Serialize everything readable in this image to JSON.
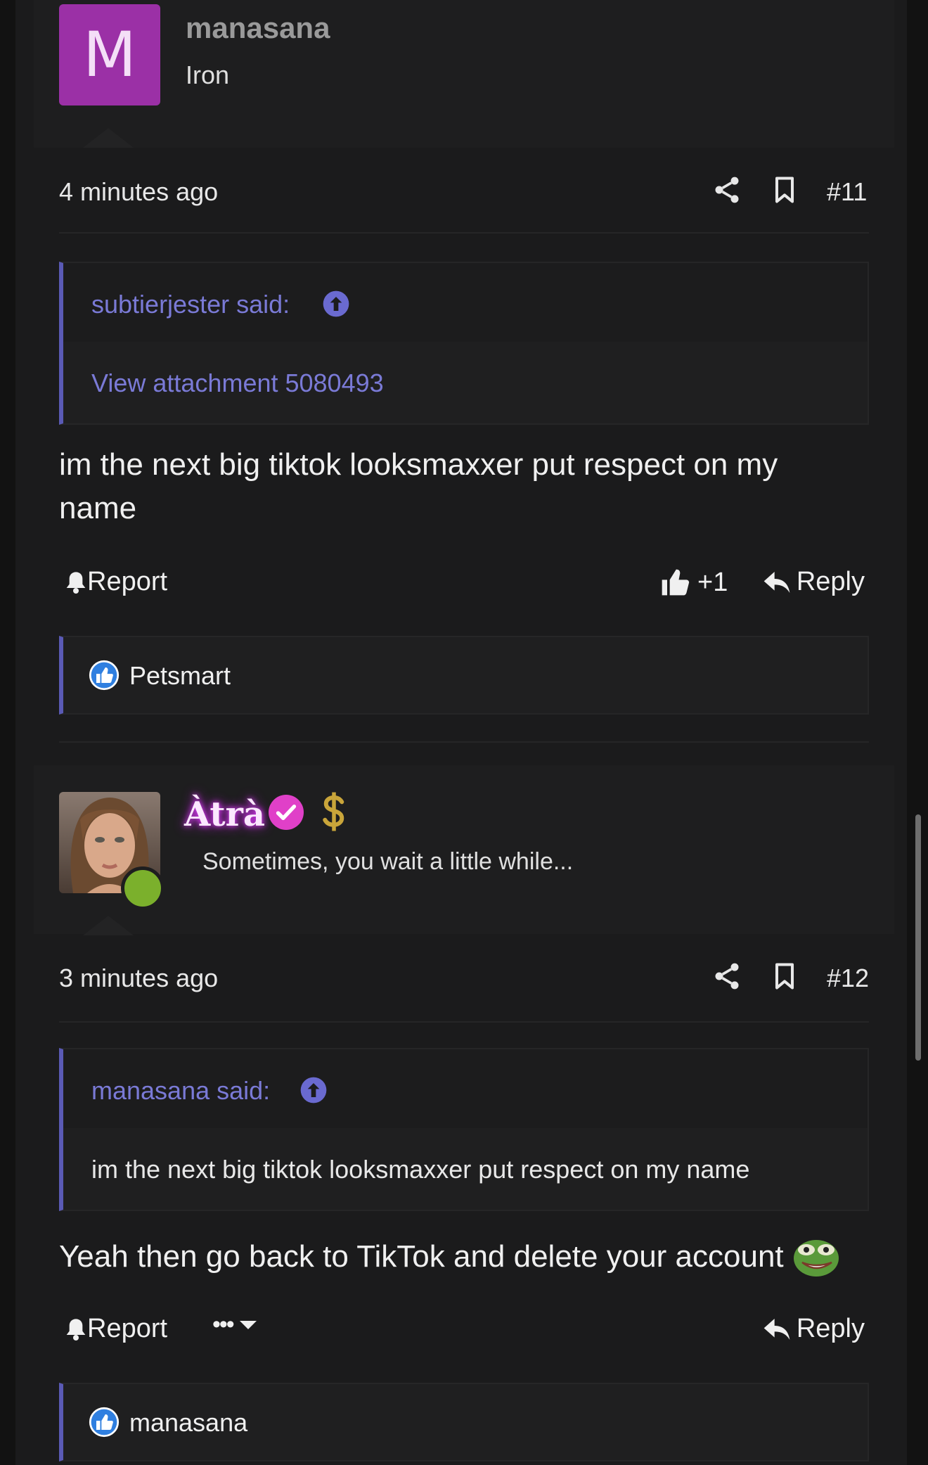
{
  "posts": [
    {
      "username": "manasana",
      "avatar_letter": "M",
      "user_title": "Iron",
      "time": "4 minutes ago",
      "post_number": "#11",
      "quote": {
        "author": "subtierjester said:",
        "body": "View attachment 5080493"
      },
      "text_line1": "im the next big tiktok looksmaxxer put respect on my",
      "text_line2": "name",
      "actions": {
        "report": "Report",
        "reaction_count": "+1",
        "reply": "Reply"
      },
      "reactions": [
        "Petsmart"
      ]
    },
    {
      "username": "Àtrà",
      "user_title": "Sometimes, you wait a little while...",
      "time": "3 minutes ago",
      "post_number": "#12",
      "quote": {
        "author": "manasana said:",
        "body": "im the next big tiktok looksmaxxer put respect on my name"
      },
      "text": "Yeah then go back to TikTok and delete your account",
      "actions": {
        "report": "Report",
        "more": "•••",
        "reply": "Reply"
      },
      "reactions": [
        "manasana"
      ]
    }
  ],
  "colors": {
    "background": "#1b1b1c",
    "accent": "#5a5ab5",
    "quote_author": "#7a7ad6",
    "avatar_purple": "#9b30a6",
    "verified_pink": "#e040c8",
    "online_green": "#7bb02c"
  },
  "icons": {
    "share": "share-icon",
    "bookmark": "bookmark-icon",
    "bell": "bell-icon",
    "thumbs_up": "thumbs-up-icon",
    "reply": "reply-arrow-icon",
    "up_arrow": "arrow-up-circle-icon",
    "verified": "verified-badge-icon",
    "dollar": "dollar-icon",
    "like_badge": "like-badge-icon",
    "emoji": "pepe-emoji-icon"
  }
}
